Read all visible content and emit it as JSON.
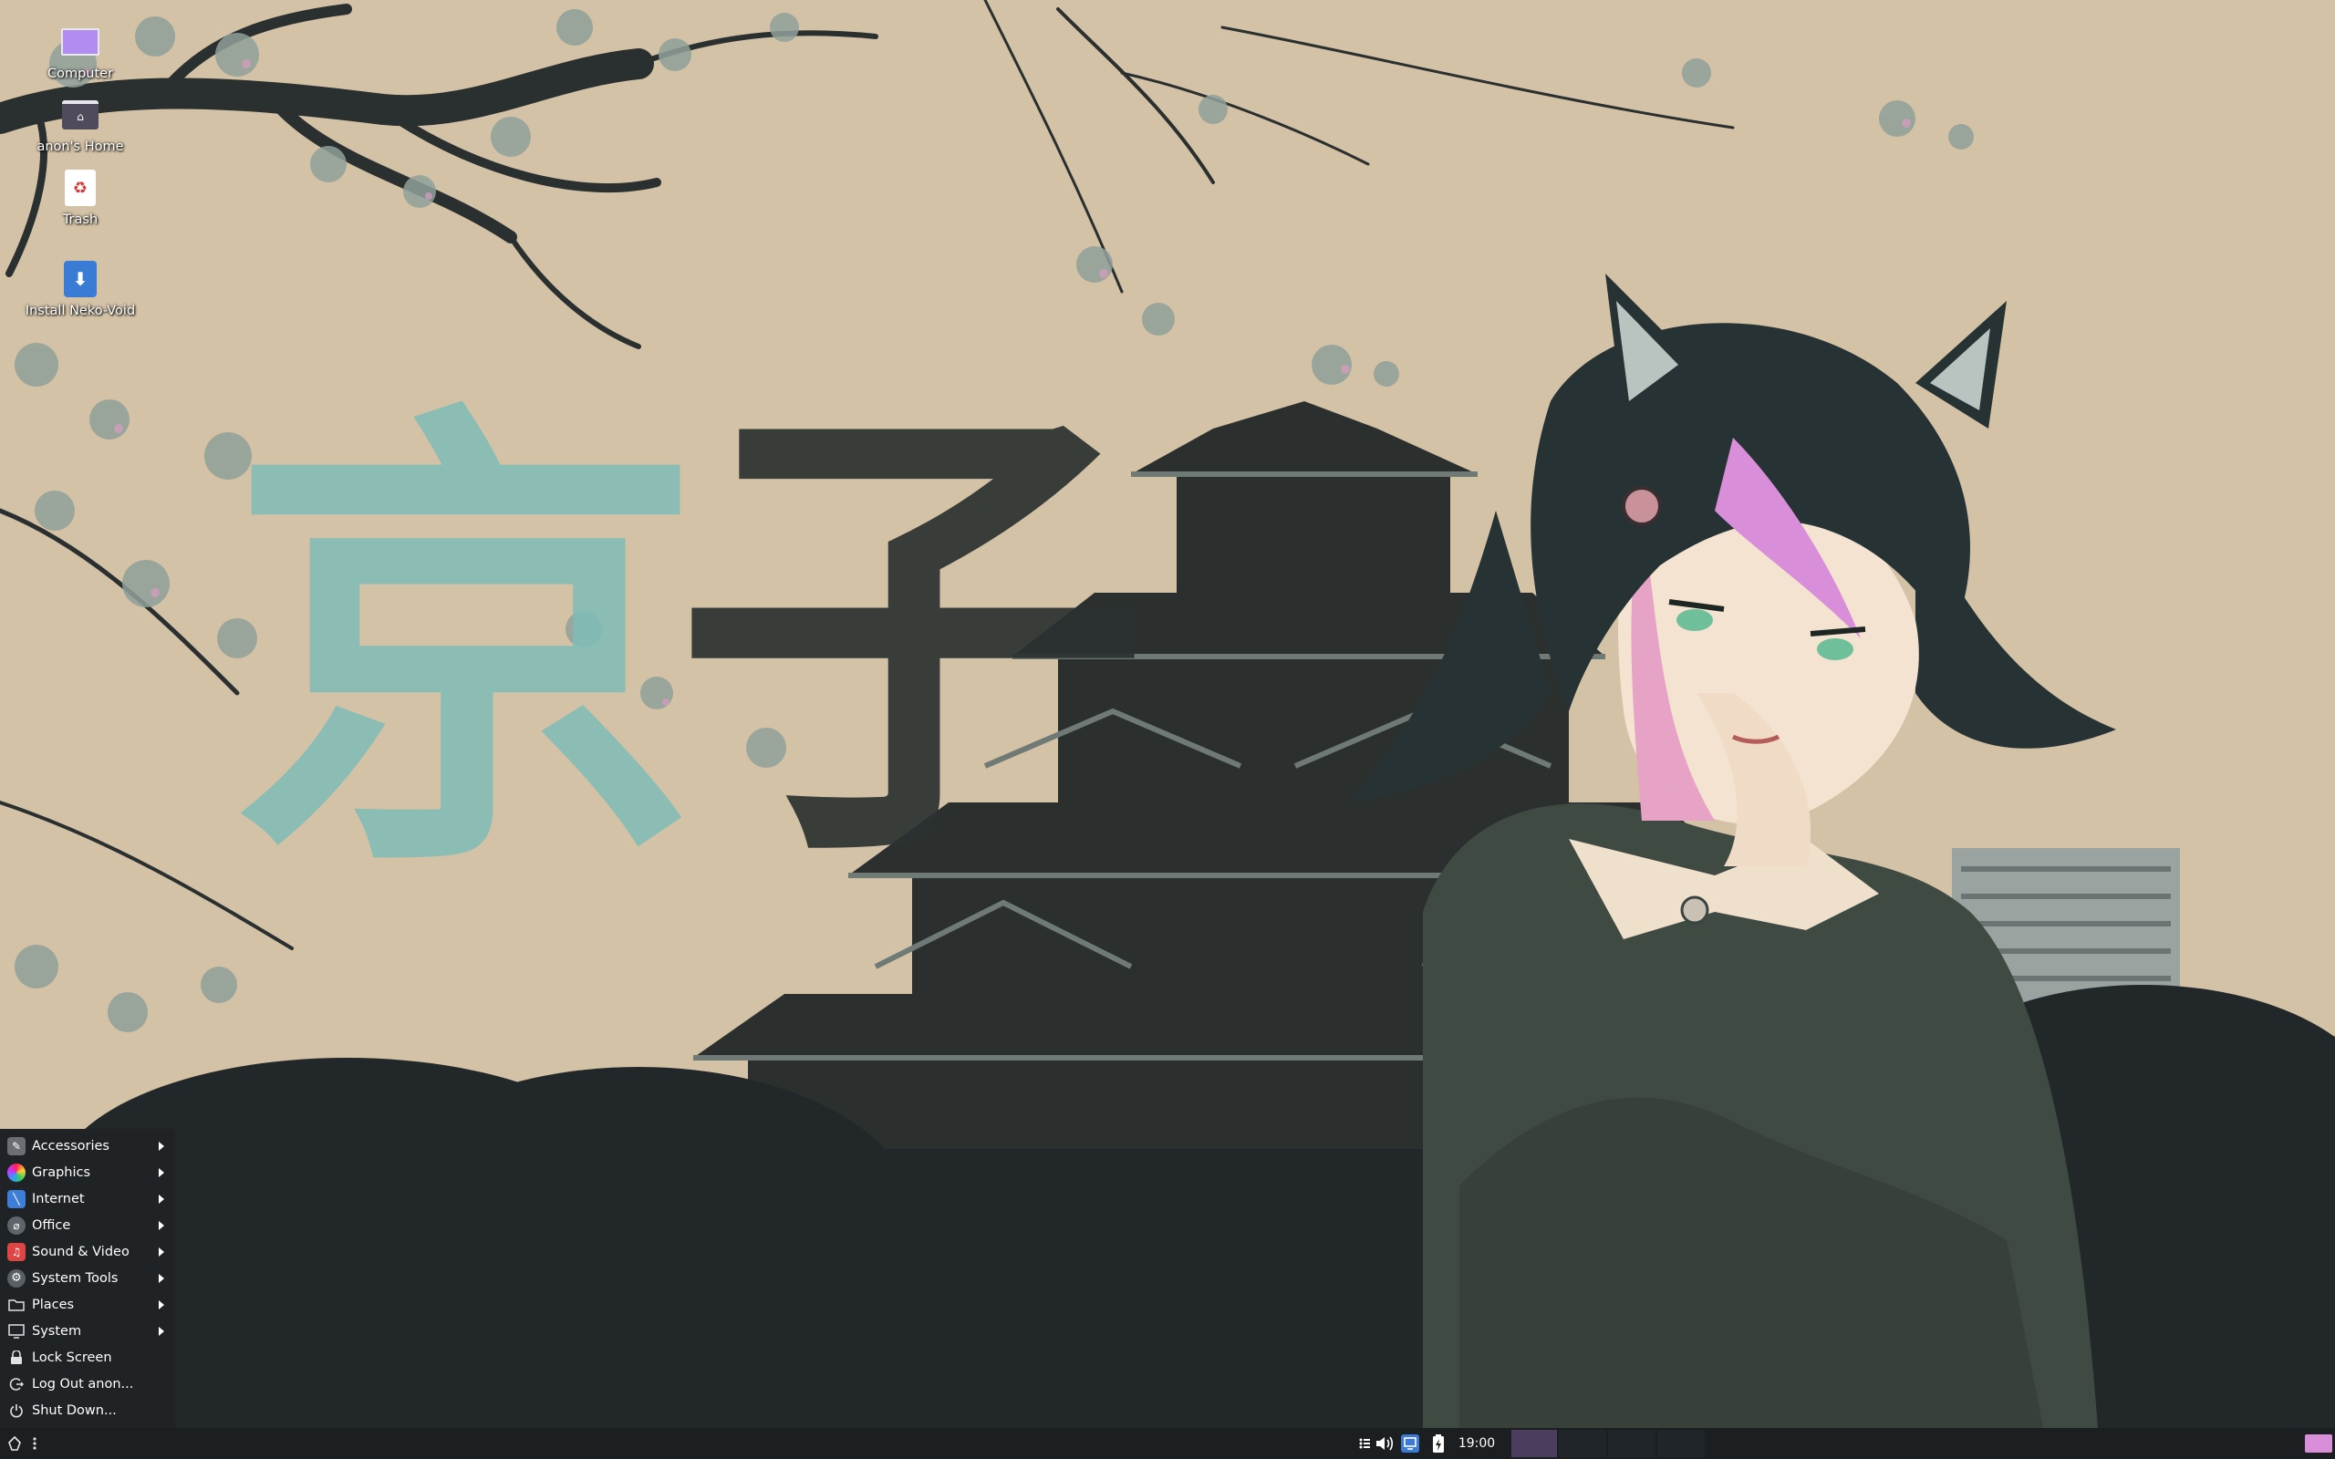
{
  "desktop": {
    "icons": [
      {
        "label": "Computer",
        "icon": "computer-icon"
      },
      {
        "label": "anon's Home",
        "icon": "home-folder-icon"
      },
      {
        "label": "Trash",
        "icon": "trash-icon"
      },
      {
        "label": "Install Neko-Void",
        "icon": "installer-icon"
      }
    ]
  },
  "wallpaper": {
    "kanji": "京子"
  },
  "menu": {
    "items": [
      {
        "label": "Accessories",
        "icon": "accessories-icon",
        "submenu": true
      },
      {
        "label": "Graphics",
        "icon": "graphics-icon",
        "submenu": true
      },
      {
        "label": "Internet",
        "icon": "internet-icon",
        "submenu": true
      },
      {
        "label": "Office",
        "icon": "office-icon",
        "submenu": true
      },
      {
        "label": "Sound & Video",
        "icon": "sound-video-icon",
        "submenu": true
      },
      {
        "label": "System Tools",
        "icon": "system-tools-icon",
        "submenu": true
      },
      {
        "label": "Places",
        "icon": "folder-icon",
        "submenu": true
      },
      {
        "label": "System",
        "icon": "monitor-icon",
        "submenu": true
      },
      {
        "label": "Lock Screen",
        "icon": "lock-icon",
        "submenu": false
      },
      {
        "label": "Log Out anon...",
        "icon": "logout-icon",
        "submenu": false
      },
      {
        "label": "Shut Down...",
        "icon": "power-icon",
        "submenu": false
      }
    ]
  },
  "taskbar": {
    "clock": "19:00",
    "tray_icons": [
      "menu-icon",
      "volume-icon",
      "network-icon",
      "battery-icon"
    ],
    "workspaces": 4,
    "active_workspace": 1
  },
  "colors": {
    "panel": "#1b1f21",
    "menu_bg": "#1f2326",
    "active_workspace": "#4a3d5e",
    "wallpaper_sky": "#d3c2a6",
    "accent_pink": "#d98ed9"
  }
}
